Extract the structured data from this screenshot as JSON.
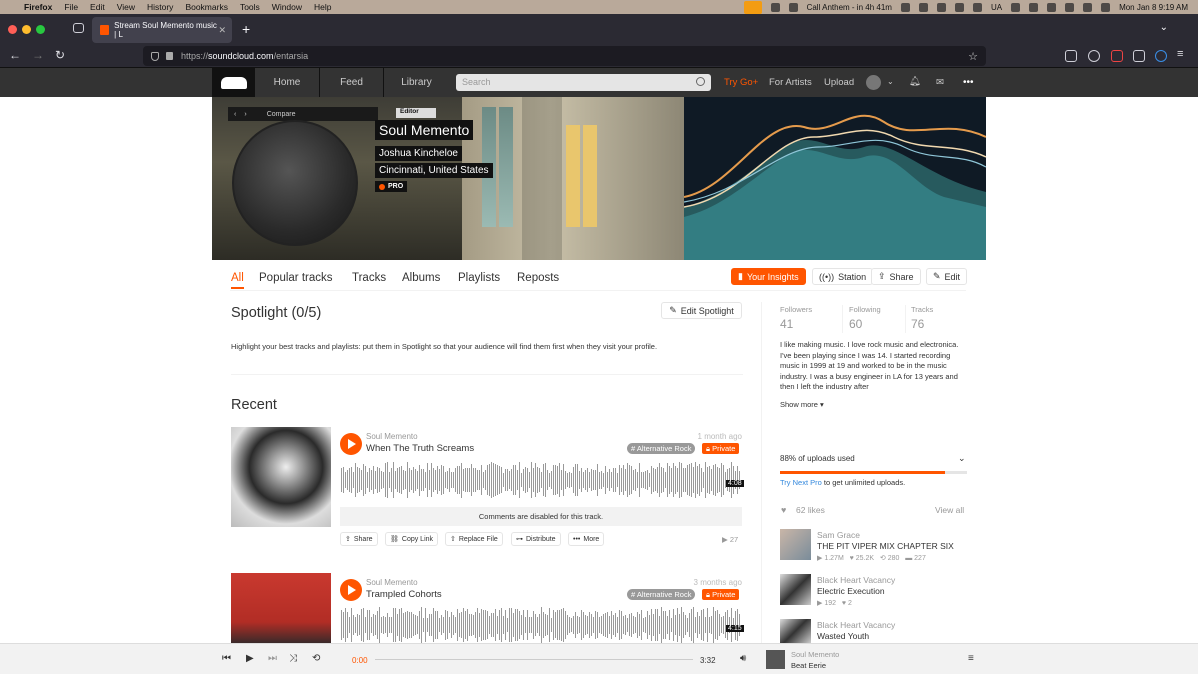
{
  "menubar": {
    "apple": "",
    "items": [
      "Firefox",
      "File",
      "Edit",
      "View",
      "History",
      "Bookmarks",
      "Tools",
      "Window",
      "Help"
    ],
    "call": "Call Anthem - in 4h 41m",
    "kbd": "UA",
    "datetime": "Mon Jan 8  9:19 AM"
  },
  "browser": {
    "tab_title": "Stream Soul Memento music | L",
    "url_prefix": "https://",
    "url_host": "soundcloud.com",
    "url_path": "/entarsia"
  },
  "header": {
    "nav": [
      "Home",
      "Feed",
      "Library"
    ],
    "search_placeholder": "Search",
    "try_go": "Try Go+",
    "for_artists": "For Artists",
    "upload": "Upload",
    "more": "•••"
  },
  "profile": {
    "display_name": "Soul Memento",
    "real_name": "Joshua Kincheloe",
    "location": "Cincinnati, United States",
    "badge": "PRO",
    "banner_text": {
      "compare": "Compare",
      "editor": "Editor"
    }
  },
  "profile_tabs": [
    "All",
    "Popular tracks",
    "Tracks",
    "Albums",
    "Playlists",
    "Reposts"
  ],
  "actions": {
    "insights": "Your Insights",
    "station": "Station",
    "share": "Share",
    "edit": "Edit"
  },
  "spotlight": {
    "title": "Spotlight (0/5)",
    "edit_button": "Edit Spotlight",
    "text": "Highlight your best tracks and playlists: put them in Spotlight so that your audience will find them first when they visit your profile."
  },
  "recent_title": "Recent",
  "tracks": [
    {
      "user": "Soul Memento",
      "title": "When The Truth Screams",
      "date": "1 month ago",
      "genre": "# Alternative Rock",
      "privacy": "Private",
      "duration": "4:08",
      "comments": "Comments are disabled for this track.",
      "buttons": [
        "Share",
        "Copy Link",
        "Replace File",
        "Distribute",
        "More"
      ],
      "plays": "27"
    },
    {
      "user": "Soul Memento",
      "title": "Trampled Cohorts",
      "date": "3 months ago",
      "genre": "# Alternative Rock",
      "privacy": "Private",
      "duration": "4:15"
    }
  ],
  "stats": [
    {
      "label": "Followers",
      "value": "41"
    },
    {
      "label": "Following",
      "value": "60"
    },
    {
      "label": "Tracks",
      "value": "76"
    }
  ],
  "bio": "I like making music. I love rock music and electronica. I've been playing since I was 14. I started recording music in 1999 at 19 and worked to be in the music industry. I was a busy engineer in LA for 13 years and then I left the industry after",
  "show_more": "Show more",
  "uploads": {
    "text": "88% of uploads used",
    "fraction": 0.88,
    "link": "Try Next Pro",
    "rest": " to get unlimited uploads."
  },
  "likes": {
    "count": "62 likes",
    "view_all": "View all"
  },
  "liked": [
    {
      "user": "Sam Grace",
      "title": "THE PIT VIPER MIX CHAPTER SIX",
      "plays": "1.27M",
      "likes": "25.2K",
      "reposts": "280",
      "comments": "227"
    },
    {
      "user": "Black Heart Vacancy",
      "title": "Electric Execution",
      "plays": "192",
      "likes": "2"
    },
    {
      "user": "Black Heart Vacancy",
      "title": "Wasted Youth"
    }
  ],
  "player": {
    "current": "0:00",
    "duration": "3:32",
    "user": "Soul Memento",
    "title": "Beat Eerie"
  },
  "colors": {
    "accent": "#ff5500",
    "header": "#333333",
    "browser": "#2b2a33"
  }
}
